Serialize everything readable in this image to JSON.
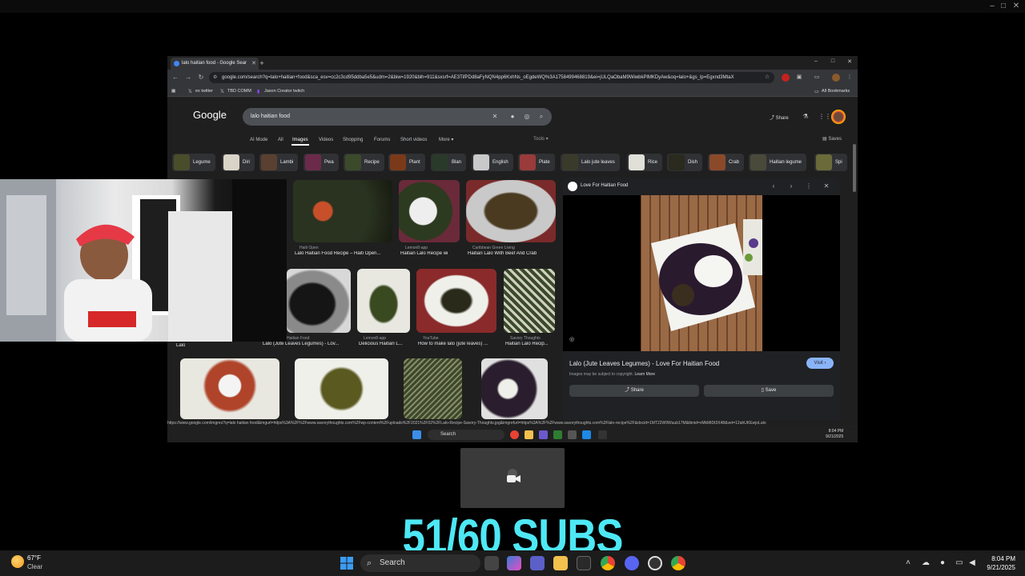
{
  "browser": {
    "tab_title": "lalo haitian food - Google Sear",
    "url": "google.com/search?q=lalo+haitian+food&sca_esv=cc2c3cd95ddba5e5&udm=2&biw=1920&bih=911&sxsrf=AE3TifPDd8aFyNQN4pp6KxhNs_oEgdeWQ%3A1758499468819&ei=jULQaObaM9WiwbkPlMKDyAw&oq=lalo+&gs_lp=Egxnd3MtaX",
    "bookmarks": [
      {
        "label": "ex twitter"
      },
      {
        "label": "TBD COMM"
      },
      {
        "label": "Jason Creator twitch"
      }
    ],
    "all_bookmarks": "All Bookmarks",
    "status_url": "https://www.google.com/imgres?q=lalo haitian food&imgurl=https%3A%2F%2Fwww.savorythoughts.com%2Fwp-content%2Fuploads%2F2021%2F02%2FLalo-Recipe-Savory-Thoughts.jpg&imgrefurl=https%3A%2F%2Fwww.savorythoughts.com%2Flalo-recipe%2F&docid=1MT22W9Wuub17M&tbnid=vMkMtDt3X48&vet=12ahUKEwjoLalo"
  },
  "google": {
    "logo": "Google",
    "query": "lalo haitian food",
    "share": "Share",
    "saves": "Saves",
    "tools": "Tools",
    "tabs": [
      {
        "label": "AI Mode",
        "active": false
      },
      {
        "label": "All",
        "active": false
      },
      {
        "label": "Images",
        "active": true
      },
      {
        "label": "Videos",
        "active": false
      },
      {
        "label": "Shopping",
        "active": false
      },
      {
        "label": "Forums",
        "active": false
      },
      {
        "label": "Short videos",
        "active": false
      },
      {
        "label": "More",
        "active": false
      }
    ],
    "chips": [
      "Legume",
      "Diri",
      "Lambi",
      "Pwa",
      "Recipe",
      "Plant",
      "Blan",
      "English",
      "Plate",
      "Lalo jute leaves",
      "Rice",
      "Dish",
      "Crab",
      "Haitian legume",
      "Spi"
    ],
    "results": [
      {
        "source": "Haiti Open",
        "title": "Lalo Haitian Food Recipe – Haiti Open..."
      },
      {
        "source": "Lemon8-app",
        "title": "Haitian Lalo Recipe wi"
      },
      {
        "source": "Caribbean Green Living",
        "title": "Haitian Lalo With Beef And Crab"
      },
      {
        "source": "Haitian Food",
        "title": "Lalo (Jute Leaves Legumes) - Lov..."
      },
      {
        "source": "Lemon8-app",
        "title": "Delicious Haitian L..."
      },
      {
        "source": "YouTube",
        "title": "How to make lalo (jute leaves) ..."
      },
      {
        "source": "Savory Thoughts",
        "title": "Haitian Lalo Recip..."
      },
      {
        "source": "",
        "title": "Lalo"
      }
    ],
    "panel": {
      "source": "Love For Haitian Food",
      "title": "Lalo (Jute Leaves Legumes) - Love For Haitian Food",
      "note": "Images may be subject to copyright.",
      "learn_more": "Learn More",
      "visit": "Visit",
      "share": "Share",
      "save": "Save"
    }
  },
  "inner_taskbar": {
    "search": "Search",
    "time": "8:04 PM",
    "date": "9/21/2025"
  },
  "overlay": {
    "subs": "51/60 SUBS"
  },
  "taskbar": {
    "weather_temp": "67°F",
    "weather_cond": "Clear",
    "search": "Search",
    "time": "8:04 PM",
    "date": "9/21/2025"
  }
}
